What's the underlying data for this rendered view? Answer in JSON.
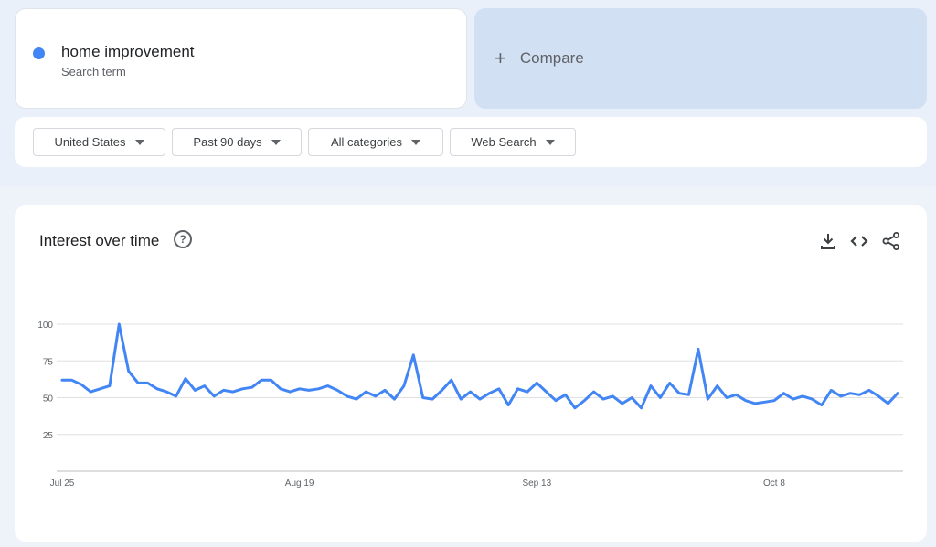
{
  "search_term": {
    "name": "home improvement",
    "subtitle": "Search term",
    "color": "#4285f4"
  },
  "compare": {
    "plus": "+",
    "label": "Compare"
  },
  "filters": [
    {
      "label": "United States"
    },
    {
      "label": "Past 90 days"
    },
    {
      "label": "All categories"
    },
    {
      "label": "Web Search"
    }
  ],
  "chart_header": {
    "title": "Interest over time",
    "help_icon": "help-circle-icon",
    "icons": [
      "download-icon",
      "embed-code-icon",
      "share-icon"
    ]
  },
  "chart_data": {
    "type": "line",
    "title": "",
    "xlabel": "",
    "ylabel": "",
    "ylim": [
      0,
      100
    ],
    "y_ticks": [
      25,
      50,
      75,
      100
    ],
    "x_ticks": [
      "Jul 25",
      "Aug 19",
      "Sep 13",
      "Oct 8"
    ],
    "x_tick_indices": [
      0,
      25,
      50,
      75
    ],
    "grid": true,
    "line_color": "#4285f4",
    "series": [
      {
        "values": [
          62,
          62,
          59,
          54,
          56,
          58,
          100,
          68,
          60,
          60,
          56,
          54,
          51,
          63,
          55,
          58,
          51,
          55,
          54,
          56,
          57,
          62,
          62,
          56,
          54,
          56,
          55,
          56,
          58,
          55,
          51,
          49,
          54,
          51,
          55,
          49,
          58,
          79,
          50,
          49,
          55,
          62,
          49,
          54,
          49,
          53,
          56,
          45,
          56,
          54,
          60,
          54,
          48,
          52,
          43,
          48,
          54,
          49,
          51,
          46,
          50,
          43,
          58,
          50,
          60,
          53,
          52,
          83,
          49,
          58,
          50,
          52,
          48,
          46,
          47,
          48,
          53,
          49,
          51,
          49,
          45,
          55,
          51,
          53,
          52,
          55,
          51,
          46,
          53
        ]
      }
    ]
  }
}
